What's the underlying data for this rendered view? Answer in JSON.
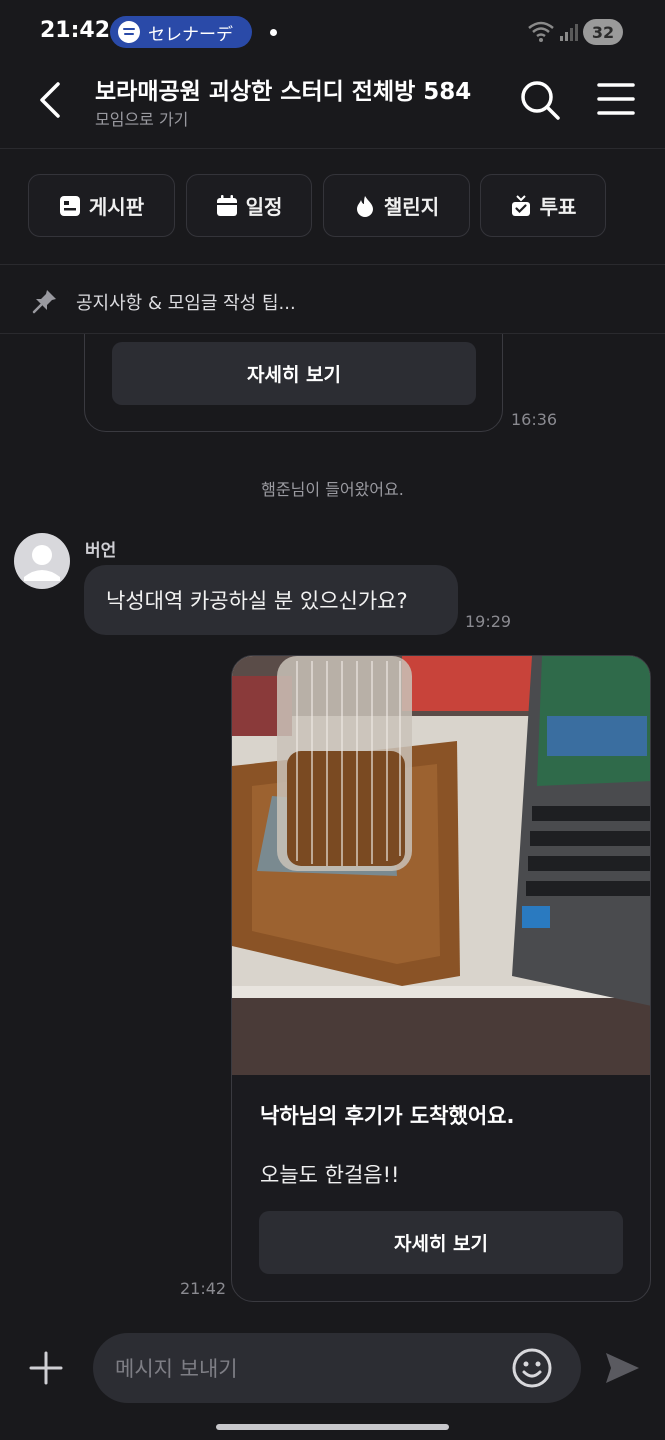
{
  "status_bar": {
    "time": "21:42",
    "spotify_label": "セレナーデ",
    "battery": "32"
  },
  "header": {
    "title": "보라매공원 괴상한 스터디 전체방 584",
    "subtitle": "모임으로 가기"
  },
  "tools": [
    {
      "label": "게시판",
      "icon": "board-icon"
    },
    {
      "label": "일정",
      "icon": "calendar-icon"
    },
    {
      "label": "챌린지",
      "icon": "flame-icon"
    },
    {
      "label": "투표",
      "icon": "vote-icon"
    }
  ],
  "notice": {
    "text": "공지사항 & 모임글 작성 팁..."
  },
  "messages": {
    "card1": {
      "button_label": "자세히 보기",
      "time": "16:36"
    },
    "system": "햄준님이 들어왔어요.",
    "chat": {
      "sender": "버언",
      "text": "낙성대역 카공하실 분 있으신가요?",
      "time": "19:29"
    },
    "review_card": {
      "title": "낙하님의 후기가 도착했어요.",
      "body": "오늘도 한걸음!!",
      "button_label": "자세히 보기",
      "time": "21:42"
    }
  },
  "composer": {
    "placeholder": "메시지 보내기"
  },
  "colors": {
    "background": "#19191c",
    "bubble": "#2c2d33",
    "spotify_pill": "#2a4aa8"
  }
}
